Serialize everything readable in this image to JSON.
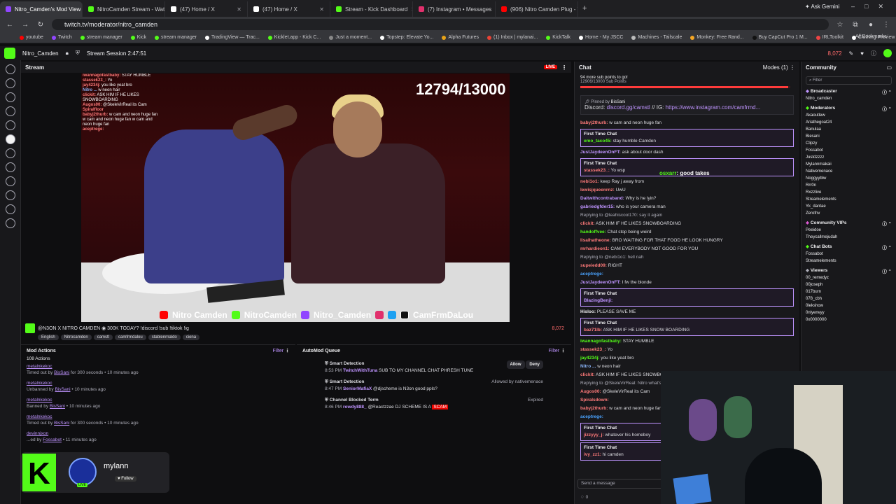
{
  "browser": {
    "tabs": [
      {
        "label": "Nitro_Camden's Mod View",
        "color": "#9146ff",
        "active": true
      },
      {
        "label": "NitroCamden Stream - Watch Live",
        "color": "#53fc18"
      },
      {
        "label": "(47) Home / X",
        "color": "#ffffff"
      },
      {
        "label": "(47) Home / X",
        "color": "#ffffff"
      },
      {
        "label": "Stream - Kick Dashboard",
        "color": "#53fc18"
      },
      {
        "label": "(7) Instagram • Messages",
        "color": "#e1306c"
      },
      {
        "label": "(906) Nitro Camden Plug - YouTube",
        "color": "#ff0000"
      }
    ],
    "ask_gemini": "Ask Gemini",
    "url": "twitch.tv/moderator/nitro_camden",
    "bookmarks": [
      "youtube",
      "Twitch",
      "stream manager",
      "Kick",
      "stream manager",
      "TradingView — Trac...",
      "Kicklet.app - Kick C...",
      "Just a moment...",
      "Topstep: Elevate Yo...",
      "Alpha Futures",
      "(1) Inbox | mylanai...",
      "KickTalk",
      "Home - My JSCC",
      "Machines - Tailscale",
      "Monkey: Free Rand...",
      "Buy CapCut Pro 1 M...",
      "IRLToolkit",
      "Clothing Preview | D..."
    ],
    "all_bookmarks": "All Bookmarks"
  },
  "topbar": {
    "channel": "Nitro_Camden",
    "session": "Stream Session 2:47:51",
    "viewer_count": "8,072"
  },
  "stream": {
    "title": "Stream",
    "live_badge": "LIVE",
    "sub_goal": "12794/13000",
    "overlay_chat": [
      {
        "user": "iwannagofastbaby:",
        "text": "STAY HUMBLE",
        "color": "#ff7a7a"
      },
      {
        "user": "stassek23_:",
        "text": "Yo",
        "color": "#ff7a7a"
      },
      {
        "user": "jay4234j:",
        "text": "you like yeat bro",
        "color": "#ff7a7a"
      },
      {
        "user": "Nitro ...",
        "text": "w neon hair",
        "color": "#8ab4f8"
      },
      {
        "user": "clickit:",
        "text": "ASK HIM IF HE LIKES SNOWBOARDING",
        "color": "#ff7a7a"
      },
      {
        "user": "Augos00:",
        "text": "@SkeleVirReal its Cam",
        "color": "#ff7a7a"
      },
      {
        "user": "Spiralfloor",
        "text": "",
        "color": "#ff7a7a"
      },
      {
        "user": "babyj2thurb:",
        "text": "w cam and neon huge fan w cam and neon huge fan w cam and neon huge fan",
        "color": "#ff7a7a"
      },
      {
        "user": "aceptrege:",
        "text": "",
        "color": "#ff7a7a"
      }
    ],
    "socials": [
      "Nitro Camden",
      "NitroCamden",
      "Nitro_Camden",
      "CamFrmDaLou"
    ],
    "info_title": "@N3ON X NITRO CAMDEN ◉ 300K TODAY? !discord !sub !tiktok !ig",
    "tags": [
      "English",
      "Nitrocamden",
      "camstl",
      "camfrmdalou",
      "stablenrnaldo",
      "ciena"
    ],
    "viewer_count": "8,072"
  },
  "mod_actions": {
    "title": "Mod Actions",
    "filter": "Filter",
    "count": "108 Actions",
    "items": [
      {
        "user": "metalnkekoc",
        "action": "Timed out by",
        "mod": "BisSani",
        "detail": "for 300 seconds",
        "time": "10 minutes ago"
      },
      {
        "user": "metalnkekoc",
        "action": "Unbanned by",
        "mod": "BisSani",
        "detail": "",
        "time": "10 minutes ago"
      },
      {
        "user": "metalnkekoc",
        "action": "Banned by",
        "mod": "BisSani",
        "detail": "",
        "time": "10 minutes ago"
      },
      {
        "user": "metalnkekoc",
        "action": "Timed out by",
        "mod": "BisSani",
        "detail": "for 300 seconds",
        "time": "10 minutes ago"
      },
      {
        "user": "devinnjxon",
        "action": "...ed by",
        "mod": "Fossabot",
        "detail": "",
        "time": "11 minutes ago"
      }
    ]
  },
  "automod": {
    "title": "AutoMod Queue",
    "filter": "Filter",
    "items": [
      {
        "label": "Smart Detection",
        "time": "8:53 PM",
        "user": "TwitchWithTuna",
        "text": "SUB TO MY CHANNEL CHAT PHRESH TUNE",
        "status": "",
        "allow": "Allow",
        "deny": "Deny"
      },
      {
        "label": "Smart Detection",
        "time": "8:47 PM",
        "user": "SeniorMafiaX",
        "text": "@djscheme is N3on good ppls?",
        "status": "Allowed by nativemenace"
      },
      {
        "label": "Channel Blocked Term",
        "time": "8:46 PM",
        "user": "rowdy888_",
        "text": "@Reactzzae DJ SCHEME IS A",
        "scam": "SCAM",
        "status": "Expired"
      }
    ]
  },
  "chat": {
    "title": "Chat",
    "modes": "Modes (1)",
    "goal_text": "94 more sub points to go!",
    "goal_sub": "12906/13000 Sub Points",
    "goal_fraction": 0.99,
    "pinned_by": "Pinned by",
    "pinned_mod": "BisSani",
    "pinned_text": "Discord:",
    "pinned_link1": "discord.gg/camstl",
    "pinned_mid": "// IG:",
    "pinned_link2": "https://www.instagram.com/camfrmd...",
    "overlay_text_user": "osxarr",
    "overlay_text": ": good takes",
    "messages": [
      {
        "user": "babyj2thurb:",
        "text": "w cam and neon huge fan",
        "color": "#ff7a7a"
      },
      {
        "first": true,
        "label": "First Time Chat",
        "user": "emo_taco45:",
        "text": "stay humble Camden",
        "color": "#53fc18"
      },
      {
        "user": "JustJaydeenOnFT:",
        "text": "ask about door dash",
        "color": "#bf94ff"
      },
      {
        "first": true,
        "label": "First Time Chat",
        "user": "stassek23_:",
        "text": "Yo wsp",
        "color": "#ff7a7a"
      },
      {
        "user": "nebi1o1:",
        "text": "keep Ray j away from",
        "color": "#ff7a7a"
      },
      {
        "user": "lewisjqueenrnz:",
        "text": "UwU",
        "color": "#ff7a7a"
      },
      {
        "user": "Daitwithcontraband:",
        "text": "Why is he lyin?",
        "color": "#bf94ff"
      },
      {
        "user": "gabriedgfder15:",
        "text": "who is your camera man",
        "color": "#bf94ff"
      },
      {
        "user": "",
        "text": "Replying to @leahiscool170: say it again",
        "color": "#adadb8"
      },
      {
        "user": "clickit:",
        "text": "ASK HIM IF HE LIKES SNOWBOARDING",
        "color": "#ff7a7a"
      },
      {
        "user": "handoffvee:",
        "text": "Chat stop being weird",
        "color": "#53fc18"
      },
      {
        "user": "lisaihatheone:",
        "text": "BRO WAITING FOR THAT FOOD HE LOOK HUNGRY",
        "color": "#ff7a7a"
      },
      {
        "user": "mrhardieon1:",
        "text": "CAM EVERYBODY NOT GOOD FOR YOU",
        "color": "#ff7a7a"
      },
      {
        "user": "",
        "text": "Replying to @nebi1o1: hell nah",
        "color": "#adadb8"
      },
      {
        "user": "supeiedd09:",
        "text": "RIGHT",
        "color": "#ff7a7a"
      },
      {
        "user": "aceptrege:",
        "text": "",
        "color": "#4aa3ff"
      },
      {
        "user": "JustJaydeenOnFT:",
        "text": "I fw the blonde",
        "color": "#bf94ff"
      },
      {
        "first": true,
        "label": "First Time Chat",
        "user": "BlazingBenji:",
        "text": "",
        "color": "#bf94ff"
      },
      {
        "user": "Hisloo:",
        "text": "PLEASE SAVE ME",
        "color": "#efeff1"
      },
      {
        "first": true,
        "label": "First Time Chat",
        "user": "baz71lb:",
        "text": "ASK HIM IF HE LIKES SNOW BOARDING",
        "color": "#ff7a7a"
      },
      {
        "user": "iwannagofastbaby:",
        "text": "STAY HUMBLE",
        "color": "#53fc18"
      },
      {
        "user": "stassek23_:",
        "text": "Yo",
        "color": "#ff7a7a"
      },
      {
        "user": "jay4234j:",
        "text": "you like yeat bro",
        "color": "#53fc18"
      },
      {
        "user": "Nitro ...",
        "text": "w neon hair",
        "color": "#8ab4f8"
      },
      {
        "user": "clickit:",
        "text": "ASK HIM IF HE LIKES SNOWBOARDING",
        "color": "#ff7a7a"
      },
      {
        "user": "",
        "text": "Replying to @SkeleVirReal: Nitro what's yo",
        "color": "#adadb8"
      },
      {
        "user": "Augos00:",
        "text": "@SkeleVirReal its Cam",
        "color": "#ff7a7a"
      },
      {
        "user": "Spiralsdown:",
        "text": "",
        "color": "#ff7a7a"
      },
      {
        "user": "babyj2thurb:",
        "text": "w cam and neon huge fan w cam",
        "color": "#ff7a7a"
      },
      {
        "user": "aceptrege:",
        "text": "",
        "color": "#4aa3ff"
      },
      {
        "first": true,
        "label": "First Time Chat",
        "user": "jizzyyy_j:",
        "text": "whatever his homeboy",
        "color": "#ff7a7a"
      },
      {
        "first": true,
        "label": "First Time Chat",
        "user": "ivy_zz1:",
        "text": "hi camden",
        "color": "#ff7a7a"
      }
    ],
    "input_placeholder": "Send a message",
    "points": "0"
  },
  "community": {
    "title": "Community",
    "filter_placeholder": "Filter",
    "sections": [
      {
        "name": "Broadcaster",
        "users": [
          "Nitro_camden"
        ]
      },
      {
        "name": "Moderators",
        "users": [
          "Akaoutlew",
          "Ariathegoat24",
          "Banulaa",
          "Biesani",
          "Clipzy",
          "Fossabot",
          "Justdzzzz",
          "Mylannmakaii",
          "Nativemenace",
          "Noggyyblw",
          "Rrr0n",
          "Rxzzlive",
          "Streamelements",
          "Yk_dantae",
          "Zerofnv"
        ]
      },
      {
        "name": "Community VIPs",
        "users": [
          "Peeidoe",
          "Theycallmejudah"
        ]
      },
      {
        "name": "Chat Bots",
        "users": [
          "Fossabot",
          "Streamelements"
        ]
      },
      {
        "name": "Viewers",
        "users": [
          "00_remedyz",
          "00joseph",
          "017burn",
          "078_cbh",
          "0lekshow",
          "0nlyenvyy",
          "0x0000000"
        ]
      }
    ]
  },
  "kick_notification": {
    "logo": "K",
    "username": "mylann",
    "follow": "Follow",
    "live": "LIVE"
  }
}
